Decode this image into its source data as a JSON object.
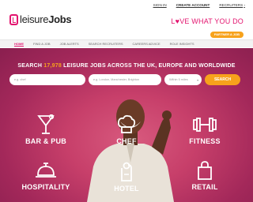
{
  "header": {
    "logo": {
      "part1": "leisure",
      "part2": "Jobs"
    },
    "top_links": {
      "signin": "SIGN IN",
      "create_account": "CREATE ACCOUNT",
      "recruiters": "RECRUITERS"
    },
    "tagline": {
      "letter_l": "L",
      "heart": "♥",
      "rest": "VE WHAT YOU DO"
    },
    "pill": "PARTNER A JOB"
  },
  "nav": {
    "items": [
      "HOME",
      "FIND A JOB",
      "JOB ALERTS",
      "SEARCH RECRUITERS",
      "CAREERS ADVICE",
      "ROLE INSIGHTS"
    ]
  },
  "hero": {
    "headline_prefix": "SEARCH ",
    "headline_number": "17,978",
    "headline_suffix": " LEISURE JOBS ACROSS THE UK, EUROPE AND WORLDWIDE",
    "search": {
      "keywords_placeholder": "e.g. chef",
      "location_placeholder": "e.g. London, Manchester, Brighton",
      "radius_value": "Within 5 miles",
      "button": "SEARCH"
    },
    "categories": [
      {
        "label": "BAR & PUB",
        "icon": "cocktail-icon"
      },
      {
        "label": "CHEF",
        "icon": "chef-hat-icon"
      },
      {
        "label": "FITNESS",
        "icon": "dumbbell-icon"
      },
      {
        "label": "HOSPITALITY",
        "icon": "reception-bell-icon"
      },
      {
        "label": "HOTEL",
        "icon": "door-hanger-icon"
      },
      {
        "label": "RETAIL",
        "icon": "shopping-bag-icon"
      }
    ]
  },
  "colors": {
    "brand_pink": "#e3146f",
    "accent_orange": "#f7a21c",
    "hero_magenta": "#c73f6a"
  }
}
